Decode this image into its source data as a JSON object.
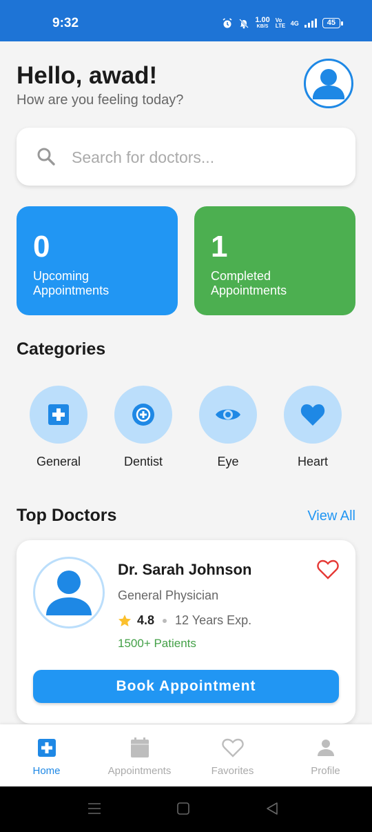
{
  "status_bar": {
    "time": "9:32",
    "net_speed_value": "1.00",
    "net_speed_unit": "KB/S",
    "volte": "Vo LTE",
    "network": "4G",
    "battery": "45"
  },
  "header": {
    "greeting": "Hello, awad!",
    "subtitle": "How are you feeling today?",
    "avatar_icon": "user-icon"
  },
  "search": {
    "placeholder": "Search for doctors...",
    "value": "",
    "icon": "search-icon"
  },
  "stats": [
    {
      "value": "0",
      "label": "Upcoming Appointments",
      "color": "#2196f3"
    },
    {
      "value": "1",
      "label": "Completed Appointments",
      "color": "#4caf50"
    }
  ],
  "categories": {
    "title": "Categories",
    "items": [
      {
        "label": "General",
        "icon": "medical-cross-icon"
      },
      {
        "label": "Dentist",
        "icon": "dentist-icon"
      },
      {
        "label": "Eye",
        "icon": "eye-icon"
      },
      {
        "label": "Heart",
        "icon": "heart-icon"
      }
    ]
  },
  "top_doctors": {
    "title": "Top Doctors",
    "view_all": "View All",
    "doctors": [
      {
        "name": "Dr. Sarah Johnson",
        "specialty": "General Physician",
        "rating": "4.8",
        "experience": "12 Years Exp.",
        "patients": "1500+ Patients",
        "book_label": "Book Appointment"
      }
    ]
  },
  "bottom_nav": [
    {
      "label": "Home",
      "icon": "home-cross-icon",
      "active": true
    },
    {
      "label": "Appointments",
      "icon": "calendar-icon",
      "active": false
    },
    {
      "label": "Favorites",
      "icon": "heart-outline-icon",
      "active": false
    },
    {
      "label": "Profile",
      "icon": "person-icon",
      "active": false
    }
  ],
  "colors": {
    "primary": "#2196f3",
    "success": "#4caf50",
    "status_bar": "#1e74d6",
    "category_bg": "#bbdefb",
    "favorite": "#e53935",
    "star": "#fbc02d"
  }
}
